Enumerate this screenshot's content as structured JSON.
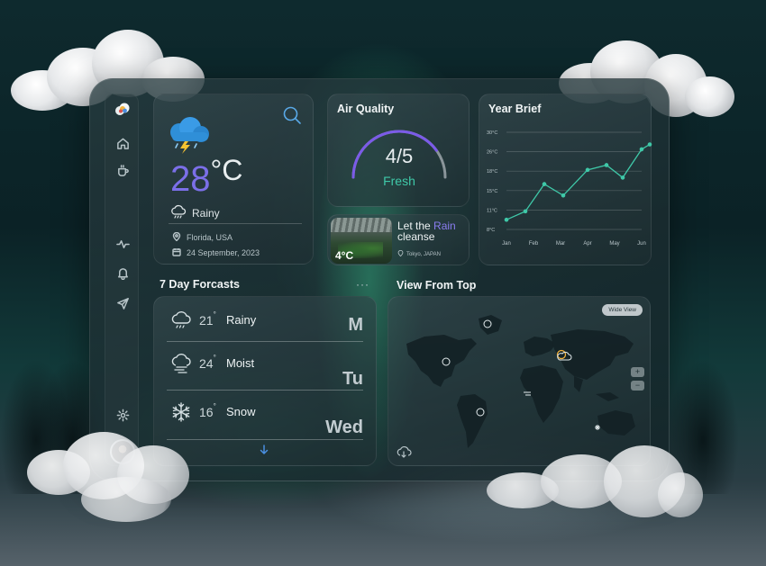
{
  "weather": {
    "temperature": "28",
    "unit": "°C",
    "condition": "Rainy",
    "location": "Florida, USA",
    "date": "24 September, 2023"
  },
  "air_quality": {
    "title": "Air Quality",
    "value": "4/5",
    "value_fraction": 0.8,
    "label": "Fresh"
  },
  "rain_card": {
    "temp": "4°C",
    "title_prefix": "Let the ",
    "title_highlight": "Rain",
    "title_suffix": "cleanse",
    "location": "Tokyo, JAPAN"
  },
  "year_brief": {
    "title": "Year Brief"
  },
  "chart_data": {
    "type": "line",
    "title": "Year Brief",
    "categories": [
      "Jan",
      "Feb",
      "Mar",
      "Apr",
      "May",
      "Jun"
    ],
    "x": [
      0,
      0.7,
      1.4,
      2.1,
      3.0,
      3.7,
      4.3,
      5.0,
      5.3
    ],
    "values": [
      9.5,
      10.8,
      16.0,
      14.0,
      18.5,
      20.5,
      17.0,
      26.5,
      27.5
    ],
    "y_ticks": [
      "30°C",
      "26°C",
      "18°C",
      "15°C",
      "11°C",
      "8°C"
    ],
    "ylim": [
      8,
      30
    ],
    "grid": true,
    "color": "#3fc8a8"
  },
  "forecast": {
    "title": "7 Day Forcasts",
    "more": "···",
    "rows": [
      {
        "temp": "21",
        "deg": "°",
        "condition": "Rainy",
        "day": "M",
        "icon": "rain-cloud-icon"
      },
      {
        "temp": "24",
        "deg": "°",
        "condition": "Moist",
        "day": "Tu",
        "icon": "fog-cloud-icon"
      },
      {
        "temp": "16",
        "deg": "°",
        "condition": "Snow",
        "day": "Wed",
        "icon": "snowflake-icon"
      }
    ]
  },
  "map": {
    "title": "View From Top",
    "wide_view": "Wide View",
    "zoom_in": "+",
    "zoom_out": "−"
  },
  "colors": {
    "accent_purple": "#7b6fe8",
    "accent_teal": "#3fc8a8"
  }
}
